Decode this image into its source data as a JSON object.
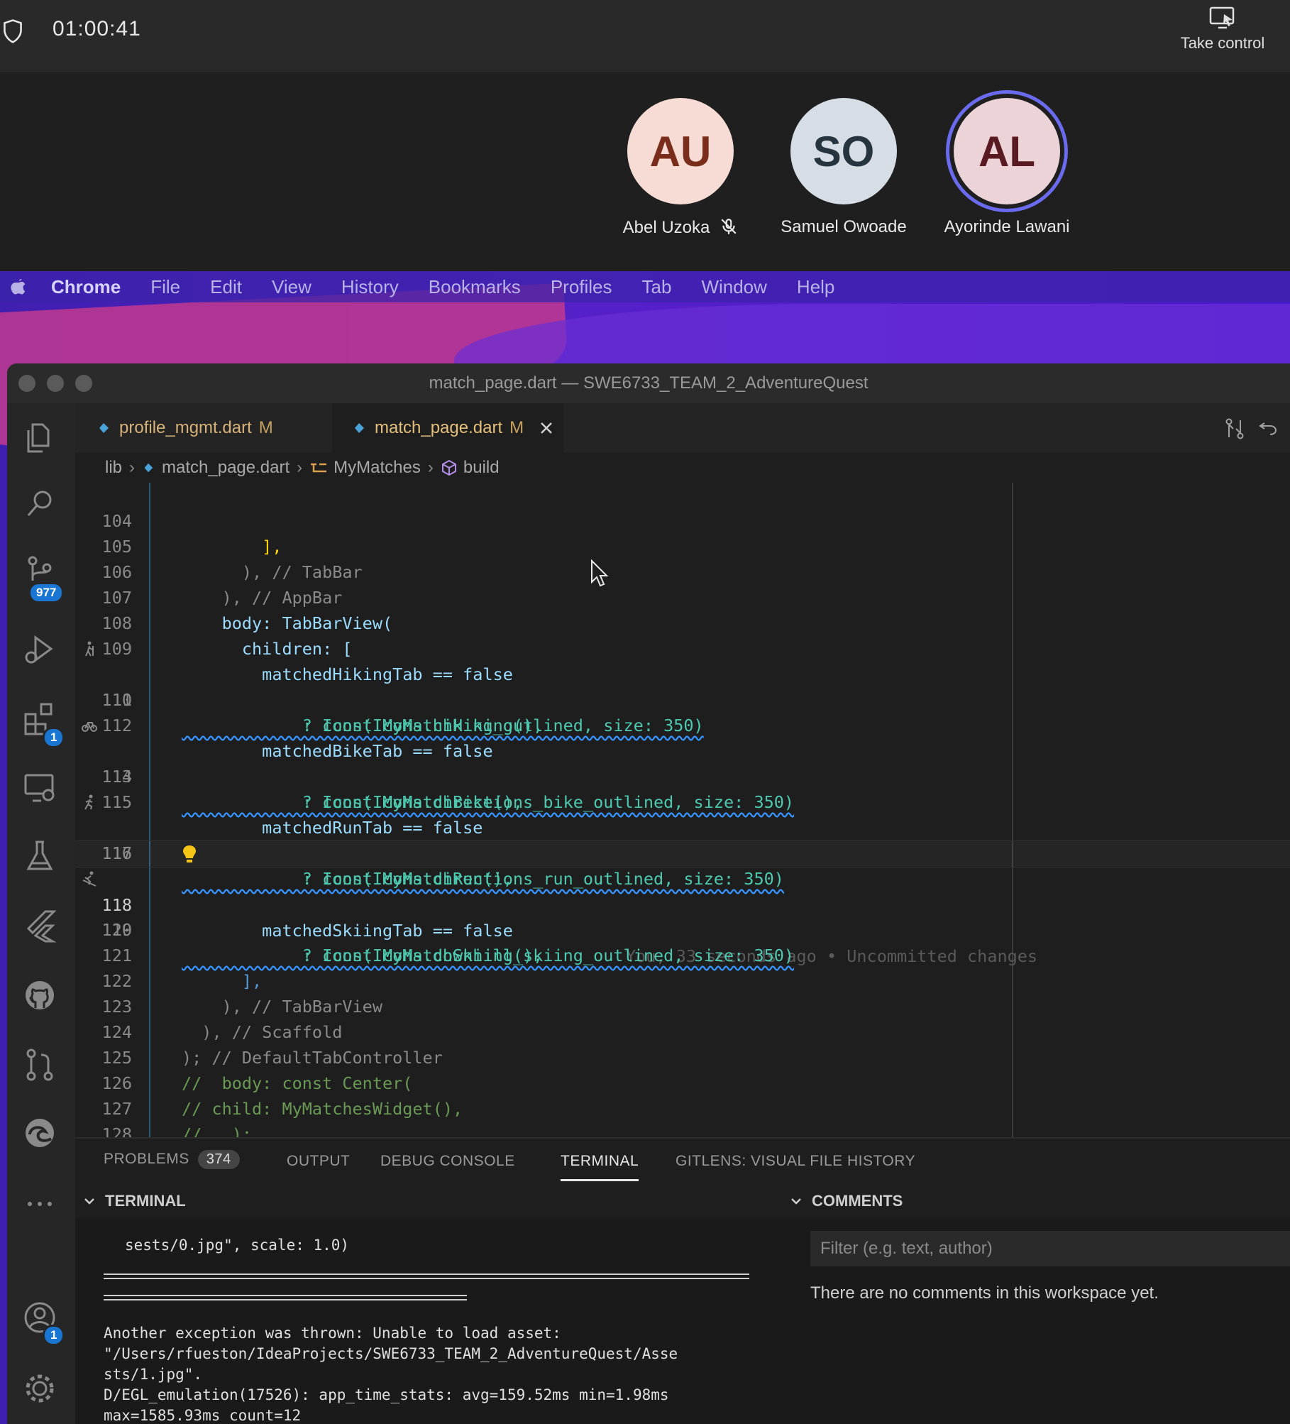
{
  "meeting": {
    "timer": "01:00:41",
    "take_control": "Take control",
    "participants": [
      {
        "initials": "AU",
        "name": "Abel Uzoka",
        "muted": true,
        "bg": "#f6dcd4",
        "fg": "#7a2d1a"
      },
      {
        "initials": "SO",
        "name": "Samuel Owoade",
        "muted": false,
        "bg": "#d6dde4",
        "fg": "#263440"
      },
      {
        "initials": "AL",
        "name": "Ayorinde Lawani",
        "muted": false,
        "bg": "#ecd3d8",
        "fg": "#5a1a22",
        "speaking_ring": "#6b6bf0"
      }
    ]
  },
  "mac_menu": {
    "app": "Chrome",
    "items": [
      "File",
      "Edit",
      "View",
      "History",
      "Bookmarks",
      "Profiles",
      "Tab",
      "Window",
      "Help"
    ]
  },
  "window": {
    "title": "match_page.dart — SWE6733_TEAM_2_AdventureQuest"
  },
  "activity": {
    "source_control_badge": "977",
    "extensions_badge": "1",
    "accounts_badge": "1"
  },
  "tabs": [
    {
      "label": "profile_mgmt.dart",
      "status": "M",
      "active": false
    },
    {
      "label": "match_page.dart",
      "status": "M",
      "active": true
    }
  ],
  "breadcrumb": [
    "lib",
    "match_page.dart",
    "MyMatches",
    "build"
  ],
  "code_lines": [
    {
      "num": "104",
      "text": "        ],"
    },
    {
      "num": "105",
      "text": "      ), // TabBar"
    },
    {
      "num": "106",
      "text": "    ), // AppBar"
    },
    {
      "num": "107",
      "text": "    body: TabBarView("
    },
    {
      "num": "108",
      "text": "      children: ["
    },
    {
      "num": "109",
      "text": "        matchedHikingTab == false"
    },
    {
      "num": "110",
      "text": "            ? Icon(Icons.hiking_outlined, size: 350)"
    },
    {
      "num": "111",
      "text": "            : const MyMatchHiking(),"
    },
    {
      "num": "112",
      "text": "        matchedBikeTab == false"
    },
    {
      "num": "113",
      "text": "            ? Icon(Icons.directions_bike_outlined, size: 350)"
    },
    {
      "num": "114",
      "text": "            : const MyMatchBike(),"
    },
    {
      "num": "115",
      "text": "        matchedRunTab == false"
    },
    {
      "num": "116",
      "text": "            ? Icon(Icons.directions_run_outlined, size: 350)"
    },
    {
      "num": "117",
      "text": "            : const MyMatchRun(),"
    },
    {
      "num": "118",
      "text": "        matchedSkiingTab == false"
    },
    {
      "num": "119",
      "text": "            ? Icon(Icons.downhill_skiing_outlined, size: 350)"
    },
    {
      "num": "120",
      "text": "            : const MyMatchSkiing(),"
    },
    {
      "num": "121",
      "text": "      ],"
    },
    {
      "num": "122",
      "text": "    ), // TabBarView"
    },
    {
      "num": "123",
      "text": "  ), // Scaffold"
    },
    {
      "num": "124",
      "text": "); // DefaultTabController"
    },
    {
      "num": "125",
      "text": "//  body: const Center("
    },
    {
      "num": "126",
      "text": "// child: MyMatchesWidget(),"
    },
    {
      "num": "127",
      "text": "//   );"
    },
    {
      "num": "128",
      "text": "}"
    }
  ],
  "blame": "You, 33 seconds ago • Uncommitted changes",
  "panel": {
    "tabs": [
      "PROBLEMS",
      "OUTPUT",
      "DEBUG CONSOLE",
      "TERMINAL",
      "GITLENS: VISUAL FILE HISTORY"
    ],
    "problems_count": "374",
    "active_tab": "TERMINAL"
  },
  "terminal": {
    "header": "TERMINAL",
    "line1": "sests/0.jpg\", scale: 1.0)",
    "line2": "Another exception was thrown: Unable to load asset:",
    "line3": "\"/Users/rfueston/IdeaProjects/SWE6733_TEAM_2_AdventureQuest/Asse",
    "line4": "sts/1.jpg\".",
    "line5": "D/EGL_emulation(17526): app_time_stats: avg=159.52ms min=1.98ms",
    "line6": "max=1585.93ms count=12"
  },
  "comments": {
    "header": "COMMENTS",
    "filter_placeholder": "Filter (e.g. text, author)",
    "empty": "There are no comments in this workspace yet."
  }
}
